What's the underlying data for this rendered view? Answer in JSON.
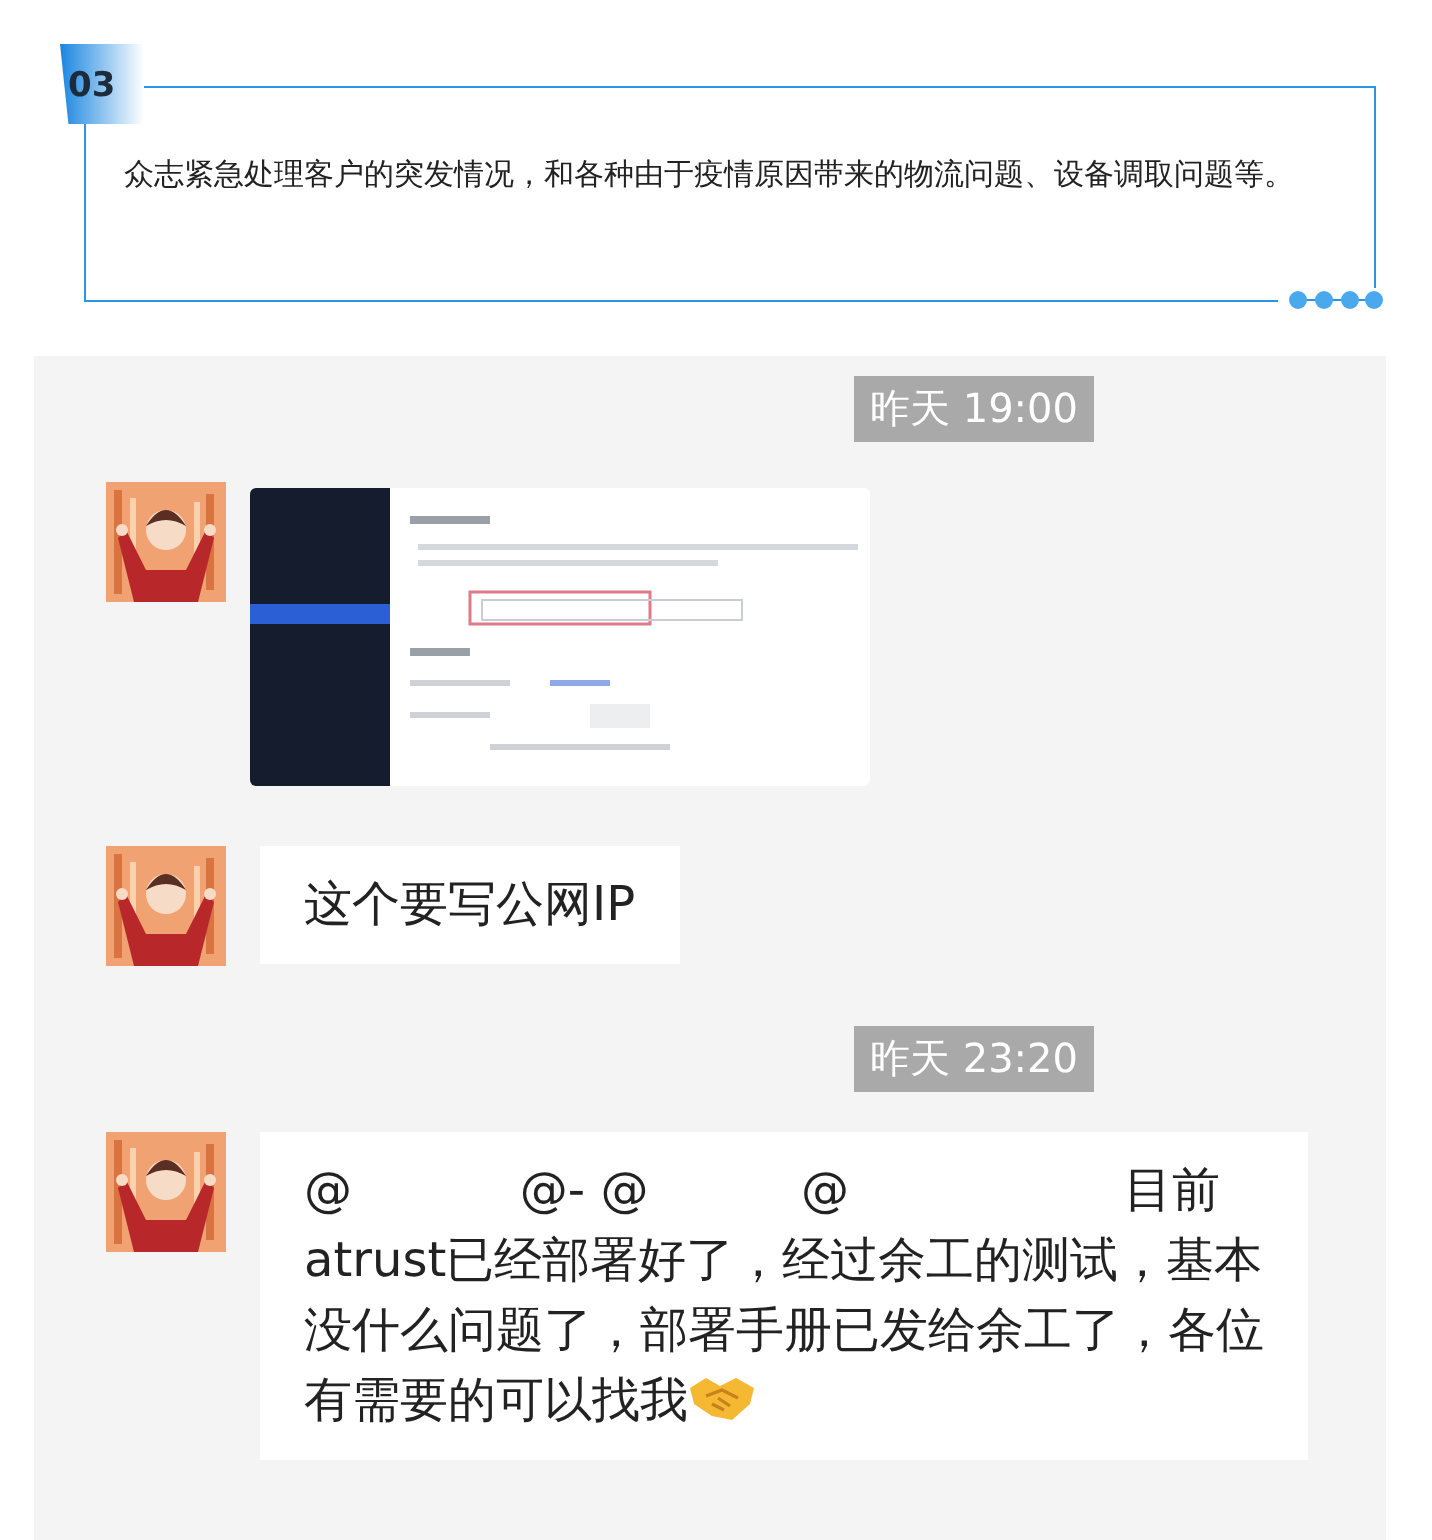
{
  "section": {
    "number": "03",
    "text": "众志紧急处理客户的突发情况，和各种由于疫情原因带来的物流问题、设备调取问题等。"
  },
  "chat": {
    "items": [
      {
        "kind": "time",
        "text": "昨天 19:00"
      },
      {
        "kind": "image"
      },
      {
        "kind": "text",
        "text": "这个要写公网IP"
      },
      {
        "kind": "time",
        "text": "昨天 23:20"
      },
      {
        "kind": "text_sticker",
        "text": "@           @- @          @                  目前\natrust已经部署好了，经过余工的测试，基本没什么问题了，部署手册已发给余工了，各位有需要的可以找我"
      }
    ]
  }
}
